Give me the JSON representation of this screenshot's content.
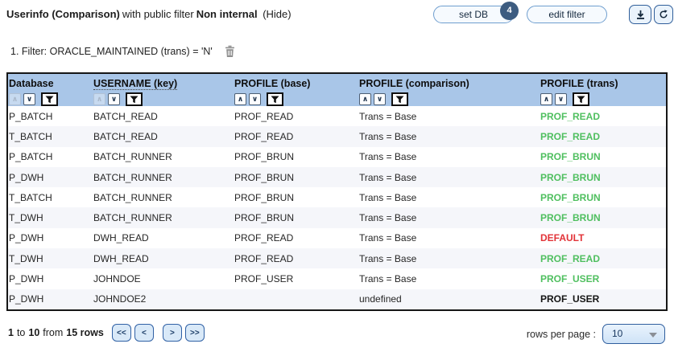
{
  "header": {
    "title_bold": "Userinfo (Comparison)",
    "title_mid": "with public filter",
    "filter_name": "Non internal",
    "hide_label": "(Hide)",
    "set_db_label": "set DB",
    "set_db_badge": "4",
    "edit_filter_label": "edit filter"
  },
  "filter_line": {
    "text": "1. Filter: ORACLE_MAINTAINED (trans) = 'N'"
  },
  "table": {
    "sort_asc_glyph": "∧",
    "sort_desc_glyph": "∨",
    "columns": [
      {
        "label": "Database",
        "asc_state": "dim"
      },
      {
        "label": "USERNAME (key)",
        "asc_state": "dim"
      },
      {
        "label": "PROFILE (base)",
        "asc_state": "std"
      },
      {
        "label": "PROFILE (comparison)",
        "asc_state": "std"
      },
      {
        "label": "PROFILE (trans)",
        "asc_state": "std"
      }
    ],
    "rows": [
      {
        "database": "P_BATCH",
        "username": "BATCH_READ",
        "profile_base": "PROF_READ",
        "profile_comparison": "Trans = Base",
        "profile_trans": "PROF_READ",
        "trans_class": "green"
      },
      {
        "database": "T_BATCH",
        "username": "BATCH_READ",
        "profile_base": "PROF_READ",
        "profile_comparison": "Trans = Base",
        "profile_trans": "PROF_READ",
        "trans_class": "green"
      },
      {
        "database": "P_BATCH",
        "username": "BATCH_RUNNER",
        "profile_base": "PROF_BRUN",
        "profile_comparison": "Trans = Base",
        "profile_trans": "PROF_BRUN",
        "trans_class": "green"
      },
      {
        "database": "P_DWH",
        "username": "BATCH_RUNNER",
        "profile_base": "PROF_BRUN",
        "profile_comparison": "Trans = Base",
        "profile_trans": "PROF_BRUN",
        "trans_class": "green"
      },
      {
        "database": "T_BATCH",
        "username": "BATCH_RUNNER",
        "profile_base": "PROF_BRUN",
        "profile_comparison": "Trans = Base",
        "profile_trans": "PROF_BRUN",
        "trans_class": "green"
      },
      {
        "database": "T_DWH",
        "username": "BATCH_RUNNER",
        "profile_base": "PROF_BRUN",
        "profile_comparison": "Trans = Base",
        "profile_trans": "PROF_BRUN",
        "trans_class": "green"
      },
      {
        "database": "P_DWH",
        "username": "DWH_READ",
        "profile_base": "PROF_READ",
        "profile_comparison": "Trans = Base",
        "profile_trans": "DEFAULT",
        "trans_class": "red"
      },
      {
        "database": "T_DWH",
        "username": "DWH_READ",
        "profile_base": "PROF_READ",
        "profile_comparison": "Trans = Base",
        "profile_trans": "PROF_READ",
        "trans_class": "green"
      },
      {
        "database": "P_DWH",
        "username": "JOHNDOE",
        "profile_base": "PROF_USER",
        "profile_comparison": "Trans = Base",
        "profile_trans": "PROF_USER",
        "trans_class": "green"
      },
      {
        "database": "P_DWH",
        "username": "JOHNDOE2",
        "profile_base": "",
        "profile_comparison": "undefined",
        "profile_trans": "PROF_USER",
        "trans_class": "black"
      }
    ]
  },
  "footer": {
    "range_start": "1",
    "to_label": "to",
    "range_end": "10",
    "from_label": "from",
    "total": "15 rows",
    "pager": {
      "first": "<<",
      "prev": "<",
      "next": ">",
      "last": ">>"
    },
    "rows_per_page_label": "rows per page :",
    "rows_per_page_value": "10"
  },
  "icons": {
    "download": "download-icon",
    "refresh": "refresh-icon",
    "trash": "trash-icon",
    "filter": "filter-funnel-icon"
  },
  "colors": {
    "header_bg": "#a9c6e8",
    "match_green": "#4fbf5f",
    "mismatch_red": "#e23338",
    "badge_bg": "#3d5c80",
    "button_border": "#2f5e9a"
  }
}
